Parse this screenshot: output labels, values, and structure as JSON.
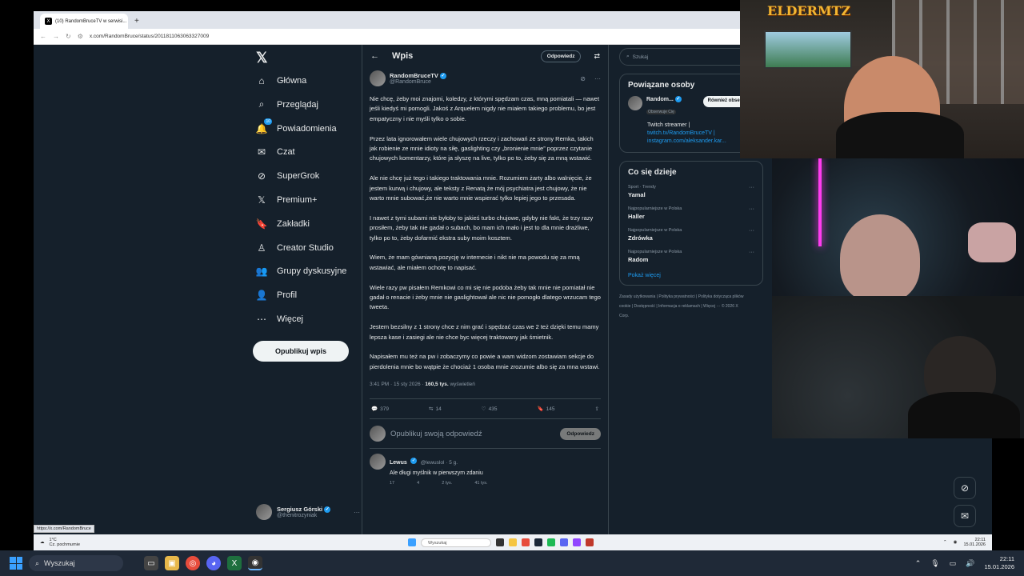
{
  "browser": {
    "tab_title": "(10) RandomBruceTV w serwisi...",
    "url": "x.com/RandomBruce/status/2011811063063327009",
    "status_link": "https://x.com/RandomBruce"
  },
  "nav": {
    "items": [
      {
        "label": "Główna",
        "icon": "home-icon"
      },
      {
        "label": "Przeglądaj",
        "icon": "search-icon"
      },
      {
        "label": "Powiadomienia",
        "icon": "bell-icon",
        "badge": "10"
      },
      {
        "label": "Czat",
        "icon": "mail-icon"
      },
      {
        "label": "SuperGrok",
        "icon": "grok-icon"
      },
      {
        "label": "Premium+",
        "icon": "x-icon"
      },
      {
        "label": "Zakładki",
        "icon": "bookmark-icon"
      },
      {
        "label": "Creator Studio",
        "icon": "creator-icon"
      },
      {
        "label": "Grupy dyskusyjne",
        "icon": "people-icon"
      },
      {
        "label": "Profil",
        "icon": "person-icon"
      },
      {
        "label": "Więcej",
        "icon": "more-icon"
      }
    ],
    "post_button": "Opublikuj wpis",
    "account": {
      "name": "Sergiusz Górski",
      "handle": "@thenitrozyniak"
    }
  },
  "main": {
    "title": "Wpis",
    "reply_button": "Odpowiedz",
    "tweet": {
      "name": "RandomBruceTV",
      "handle": "@RandomBruce",
      "paragraphs": [
        "Nie chcę, żeby moi znajomi, koledzy, z którymi spędzam czas, mną pomiatali — nawet jeśli kiedyś mi pomogli. Jakoś z Arquelem nigdy nie miałem takiego problemu, bo jest empatyczny i nie myśli tylko o sobie.",
        "Przez lata ignorowałem wiele chujowych rzeczy i zachowań ze strony Remka, takich jak robienie ze mnie idioty na siłę, gaslighting czy „bronienie mnie” poprzez czytanie chujowych komentarzy, które ja słyszę na live, tylko po to, żeby się za mną wstawić.",
        "Ale nie chcę już tego i takiego traktowania mnie. Rozumiem żarty albo walnięcie, że jestem kurwą i chujowy, ale teksty z Renatą  że mój psychiatra jest chujowy, że nie warto mnie subować,że nie warto mnie wspierać tylko lepiej jego  to przesada.",
        "I nawet z tymi subami nie byłoby to jakieś turbo chujowe, gdyby nie fakt, że trzy razy prosiłem, żeby tak nie gadał o subach, bo mam ich mało i jest to dla mnie drażliwe, tylko po to, żeby dofarmić ekstra suby moim kosztem.",
        "Wiem, że mam gównianą pozycję w internecie i nikt nie ma powodu się za mną wstawiać, ale miałem ochotę to napisać.",
        "Wiele razy pw pisałem Remkowi co mi się nie podoba żeby tak mnie nie pomiatał nie gadał o renacie i żeby mnie nie gaslightował ale nic nie pomogło dlatego wrzucam tego tweeta.",
        "Jestem bezsilny z 1 strony chce z nim grać i spędzać czas we 2 też dzięki temu mamy lepsza kase i zasiegi ale nie chce byc więcej traktowany jak śmietnik.",
        "Napisałem mu też na pw i zobaczymy co powie a wam widzom zostawiam sekcje do pierdolenia mnie bo wątpie że chociaż 1 osoba mnie zrozumie albo się za mna wstawi."
      ],
      "time": "3:41 PM · 15 sty 2026 ·",
      "views": "160,5 tys.",
      "views_label": "wyświetleń",
      "replies": "379",
      "retweets": "14",
      "likes": "435",
      "bookmarks": "145"
    },
    "compose_placeholder": "Opublikuj swoją odpowiedź",
    "compose_button": "Odpowiedz",
    "reply_tweet": {
      "name": "Lewus",
      "handle": "@lewuslol · 5 g.",
      "text": "Ale długi myślnik w pierwszym zdaniu",
      "replies": "17",
      "retweets": "4",
      "likes": "2 tys.",
      "views": "41 tys."
    }
  },
  "right": {
    "search_placeholder": "Szukaj",
    "related_title": "Powiązane osoby",
    "person": {
      "name": "Random...",
      "obs": "Obserwuje Cię",
      "follow_label": "Również obserwuj",
      "bio": "Twitch streamer |",
      "link1": "twitch.tv/RandomBruceTV |",
      "link2": "instagram.com/aleksander.kar..."
    },
    "trends_title": "Co się dzieje",
    "trends": [
      {
        "cat": "Sport · Trendy",
        "name": "Yamal"
      },
      {
        "cat": "Najpopularniejsze w Polska",
        "name": "Haller"
      },
      {
        "cat": "Najpopularniejsze w Polska",
        "name": "Zdrówka"
      },
      {
        "cat": "Najpopularniejsze w Polska",
        "name": "Radom"
      }
    ],
    "more": "Pokaż więcej",
    "footer": "Zasady użytkowania | Polityka prywatności | Polityka dotycząca plików cookie | Dostępność | Informacja o reklamach | Więcej ··· © 2026 X Corp."
  },
  "overlay": {
    "stream_logo": "ELDERMTZ"
  },
  "inner_taskbar": {
    "weather": "1°C",
    "weather_desc": "Cz. pochmurnie",
    "search": "Wyszukaj",
    "time": "22:11",
    "date": "15.01.2026"
  },
  "taskbar": {
    "search": "Wyszukaj",
    "time": "22:11",
    "date": "15.01.2026"
  }
}
